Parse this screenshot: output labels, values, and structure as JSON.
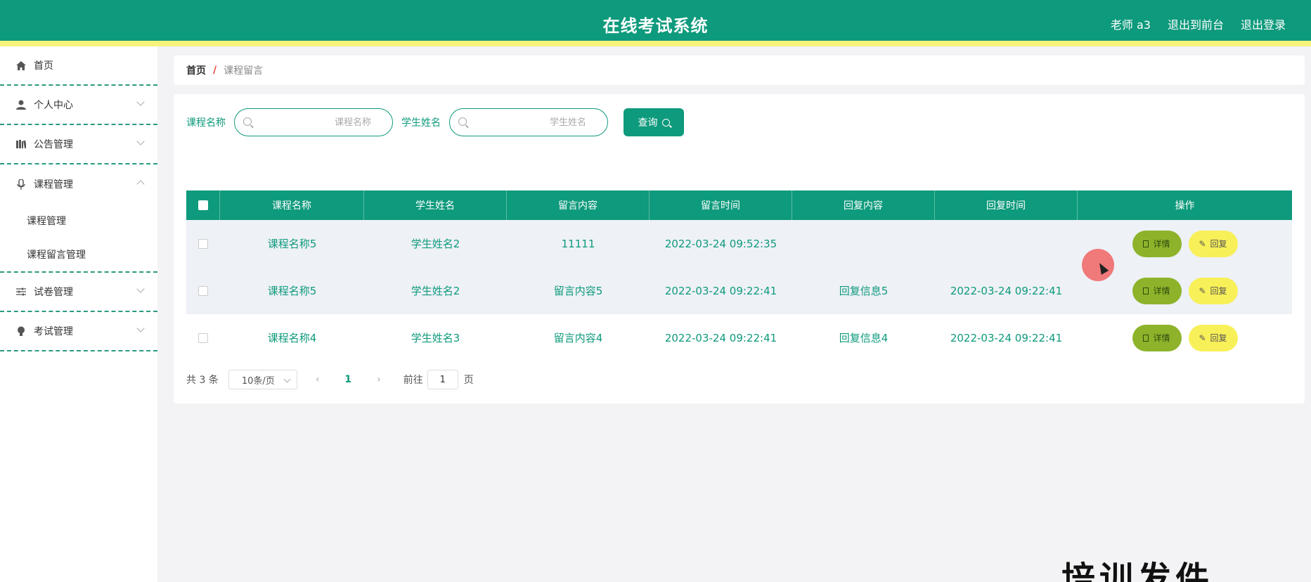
{
  "header": {
    "title": "在线考试系统",
    "user": "老师 a3",
    "to_front": "退出到前台",
    "logout": "退出登录"
  },
  "sidebar": {
    "items": [
      {
        "label": "首页",
        "icon": "home-icon"
      },
      {
        "label": "个人中心",
        "icon": "user-icon"
      },
      {
        "label": "公告管理",
        "icon": "bookshelf-icon"
      },
      {
        "label": "课程管理",
        "icon": "microphone-icon"
      },
      {
        "label": "试卷管理",
        "icon": "sliders-icon"
      },
      {
        "label": "考试管理",
        "icon": "lightbulb-icon"
      }
    ],
    "course_sub": [
      "课程管理",
      "课程留言管理"
    ]
  },
  "breadcrumb": {
    "home": "首页",
    "sep": "/",
    "current": "课程留言"
  },
  "search": {
    "course_label": "课程名称",
    "course_placeholder": "课程名称",
    "student_label": "学生姓名",
    "student_placeholder": "学生姓名",
    "query_label": "查询"
  },
  "table": {
    "headers": [
      "课程名称",
      "学生姓名",
      "留言内容",
      "留言时间",
      "回复内容",
      "回复时间",
      "操作"
    ],
    "rows": [
      [
        "课程名称5",
        "学生姓名2",
        "11111",
        "2022-03-24 09:52:35",
        "",
        ""
      ],
      [
        "课程名称5",
        "学生姓名2",
        "留言内容5",
        "2022-03-24 09:22:41",
        "回复信息5",
        "2022-03-24 09:22:41"
      ],
      [
        "课程名称4",
        "学生姓名3",
        "留言内容4",
        "2022-03-24 09:22:41",
        "回复信息4",
        "2022-03-24 09:22:41"
      ]
    ],
    "detail_label": "详情",
    "reply_label": "回复"
  },
  "pager": {
    "total": "共 3 条",
    "page_size": "10条/页",
    "current_page": "1",
    "goto_label": "前往",
    "goto_value": "1",
    "page_unit": "页"
  },
  "overlay_text": "培训发件",
  "colors": {
    "primary": "#0e9a7c",
    "accent_yellow": "#f8f37a",
    "detail_btn": "#8eb32b",
    "reply_btn": "#f8f058"
  }
}
